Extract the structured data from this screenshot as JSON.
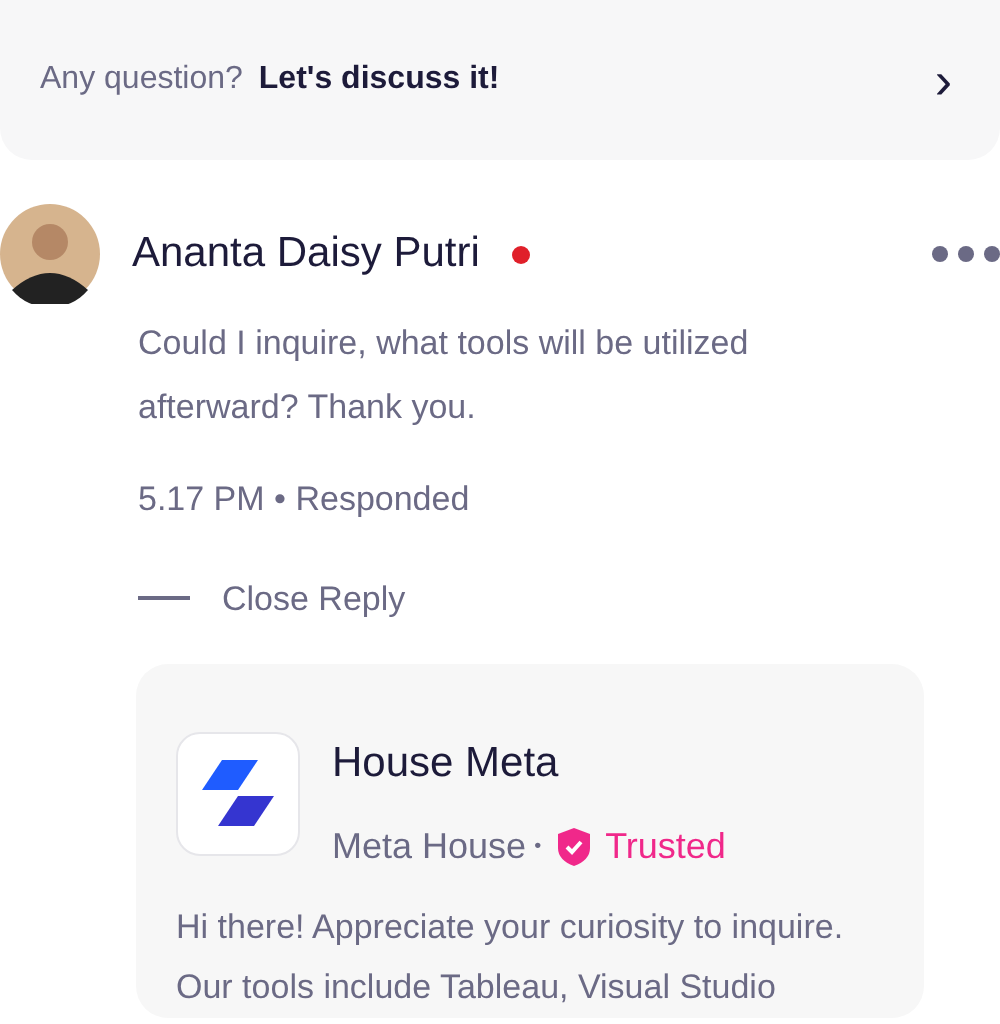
{
  "prompt_bar": {
    "question": "Any question?",
    "link": "Let's discuss it!",
    "chevron": "›"
  },
  "comment": {
    "author": "Ananta Daisy Putri",
    "online": true,
    "text": "Could I inquire, what tools will be utilized afterward? Thank you.",
    "meta": "5.17 PM • Responded",
    "toggle": "Close Reply",
    "reply": {
      "name": "House Meta",
      "handle": "Meta House",
      "separator": "•",
      "badge": "Trusted",
      "trusted": true,
      "text": "Hi there! Appreciate your curiosity to inquire. Our tools include Tableau, Visual Studio"
    }
  }
}
